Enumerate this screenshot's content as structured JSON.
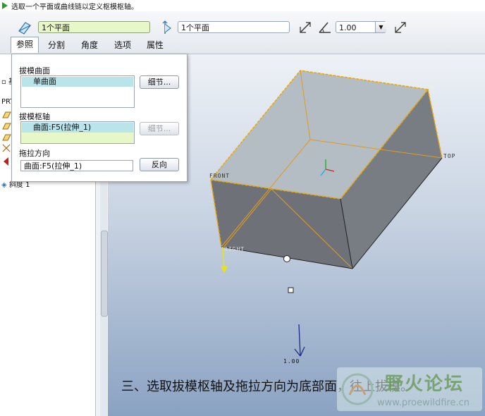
{
  "prompt": {
    "text": "选取一个平面或曲线链以定义枢模枢轴。"
  },
  "dashboard": {
    "surface_value": "1个平面",
    "axis_value": "1个平面",
    "angle_value": "1.00",
    "tabs": [
      {
        "label": "参照"
      },
      {
        "label": "分割"
      },
      {
        "label": "角度"
      },
      {
        "label": "选项"
      },
      {
        "label": "属性"
      }
    ]
  },
  "tree": {
    "rows": [
      {
        "text": "基准"
      },
      {
        "text": "PRT"
      },
      {
        "text": "斜度 1"
      }
    ]
  },
  "ref_panel": {
    "surfaces_label": "拔模曲面",
    "surfaces_item": "单曲面",
    "details_button": "细节...",
    "hinge_label": "拔模枢轴",
    "hinge_item": "曲面:F5(拉伸_1)",
    "hinge_details_button": "细节...",
    "pull_label": "拖拉方向",
    "pull_value": "曲面:F5(拉伸_1)",
    "flip_button": "反向"
  },
  "graphics": {
    "datum_front": "FRONT",
    "datum_top": "TOP",
    "datum_right": "RIGHT",
    "angle_label": "1.00",
    "caption": "三、选取拔模枢轴及拖拉方向为底部面，往上拔模。",
    "watermark_title": "野火论坛",
    "watermark_url": "www.proewildfire.cn",
    "colors": {
      "edge": "#f0a800",
      "face_dark": "#6e7278",
      "face_light": "#b4bcc4",
      "background_bottom": "#8aa2c2"
    }
  }
}
